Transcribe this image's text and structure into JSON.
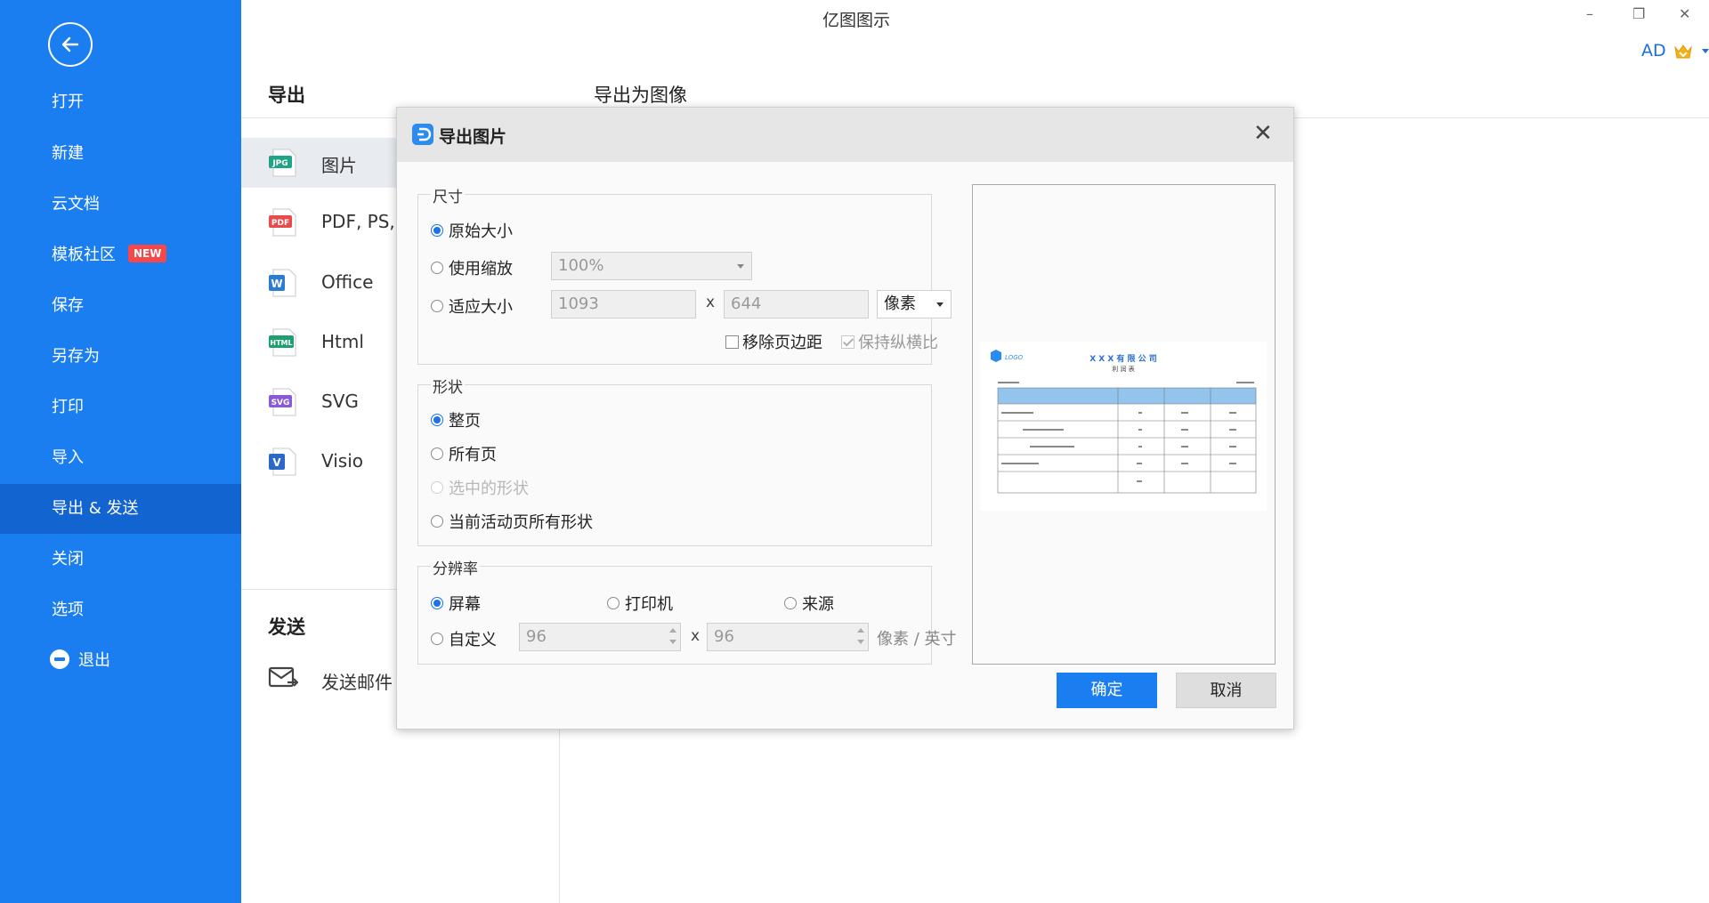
{
  "app": {
    "title": "亿图图示",
    "minimize_glyph": "–",
    "restore_glyph": "❐",
    "close_glyph": "✕"
  },
  "user": {
    "initials": "AD"
  },
  "sidebar": {
    "items": [
      {
        "label": "打开"
      },
      {
        "label": "新建"
      },
      {
        "label": "云文档"
      },
      {
        "label": "模板社区",
        "badge": "NEW"
      },
      {
        "label": "保存"
      },
      {
        "label": "另存为"
      },
      {
        "label": "打印"
      },
      {
        "label": "导入"
      },
      {
        "label": "导出 & 发送",
        "active": true
      },
      {
        "label": "关闭"
      },
      {
        "label": "选项"
      },
      {
        "label": "退出"
      }
    ]
  },
  "export_panel": {
    "export_title": "导出",
    "subtitle": "导出为图像",
    "formats": [
      {
        "label": "图片",
        "icon": "JPG",
        "color": "#20a386"
      },
      {
        "label": "PDF, PS,",
        "icon": "PDF",
        "color": "#e94a4a"
      },
      {
        "label": "Office",
        "icon": "W",
        "color": "#2b7cd3"
      },
      {
        "label": "Html",
        "icon": "HTML",
        "color": "#1f9e6f"
      },
      {
        "label": "SVG",
        "icon": "SVG",
        "color": "#8a5ad6"
      },
      {
        "label": "Visio",
        "icon": "V",
        "color": "#2b68c8"
      }
    ],
    "send_title": "发送",
    "send_email_label": "发送邮件"
  },
  "dialog": {
    "title": "导出图片",
    "size": {
      "legend": "尺寸",
      "original_size": "原始大小",
      "use_scale": "使用缩放",
      "scale_value": "100%",
      "fit_size": "适应大小",
      "width_value": "1093",
      "height_value": "644",
      "x_sep": "x",
      "unit": "像素",
      "remove_margin": "移除页边距",
      "keep_ratio": "保持纵横比"
    },
    "shape": {
      "legend": "形状",
      "whole_page": "整页",
      "all_pages": "所有页",
      "selected_shapes": "选中的形状",
      "current_page_shapes": "当前活动页所有形状"
    },
    "resolution": {
      "legend": "分辨率",
      "screen": "屏幕",
      "printer": "打印机",
      "source": "来源",
      "custom": "自定义",
      "dpi_x": "96",
      "dpi_y": "96",
      "x_sep": "x",
      "unit": "像素 / 英寸"
    },
    "preview": {
      "logo_text": "LOGO",
      "company": "X X X 有 限 公 司",
      "doc_title": "利 润 表"
    },
    "ok_label": "确定",
    "cancel_label": "取消"
  }
}
